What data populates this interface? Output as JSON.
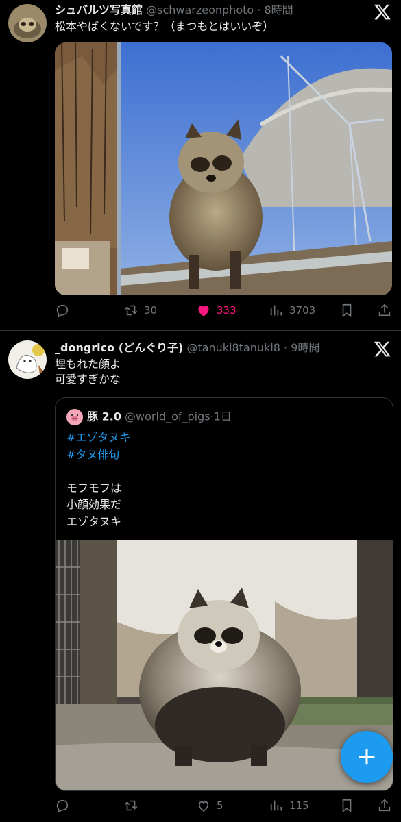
{
  "tweets": [
    {
      "display_name": "シュバルツ写真館",
      "handle": "@schwarzeonphoto",
      "time": "8時間",
      "text": "松本やばくないです？（まつもとはいいぞ）",
      "image": "raccoon-dog-behind-glass-photo",
      "stats": {
        "reply": "",
        "retweet": "30",
        "like": "333",
        "views": "3703"
      },
      "liked": true
    },
    {
      "display_name": "_dongrico (どんぐり子)",
      "handle": "@tanuki8tanuki8",
      "time": "9時間",
      "text_lines": [
        "埋もれた顔よ",
        "可愛すぎかな"
      ],
      "quote": {
        "display_name": "豚 2.0",
        "handle": "@world_of_pigs",
        "time": "1日",
        "hashtags": [
          "#エゾタヌキ",
          "#タヌ俳句"
        ],
        "lines": [
          "モフモフは",
          "小顔効果だ",
          "エゾタヌキ"
        ],
        "image": "fluffy-ezo-tanuki-photo"
      },
      "stats": {
        "reply": "",
        "retweet": "",
        "like": "5",
        "views": "115"
      },
      "liked": false
    }
  ],
  "colors": {
    "accent": "#1d9bf0",
    "like": "#f91880",
    "muted": "#71767b",
    "background": "#000000"
  },
  "fab": {
    "icon": "plus-icon"
  }
}
